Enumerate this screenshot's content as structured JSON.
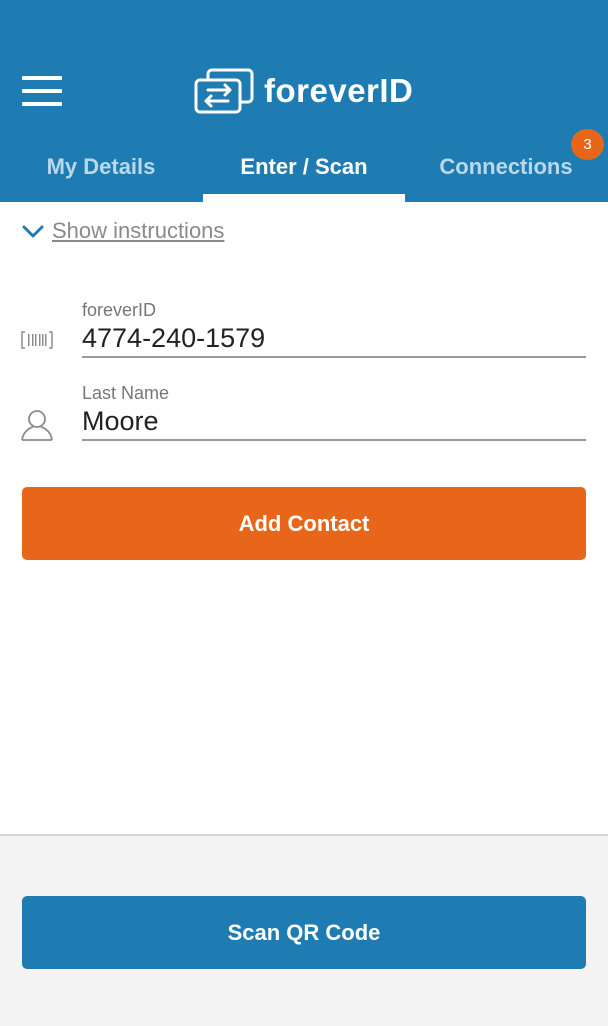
{
  "header": {
    "logo_text": "foreverID",
    "badge_count": "3",
    "tabs": [
      {
        "label": "My Details"
      },
      {
        "label": "Enter / Scan"
      },
      {
        "label": "Connections"
      }
    ],
    "colors": {
      "primary": "#1f7cb2",
      "accent": "#e8661a"
    }
  },
  "instructions": {
    "label": "Show instructions"
  },
  "form": {
    "foreverid": {
      "label": "foreverID",
      "value": "4774-240-1579"
    },
    "lastname": {
      "label": "Last Name",
      "value": "Moore"
    }
  },
  "buttons": {
    "add_contact": "Add Contact",
    "scan_qr": "Scan QR Code"
  },
  "icons": {
    "menu": "hamburger-icon",
    "logo": "exchange-arrows-icon",
    "instructions": "chevron-down-icon",
    "foreverid": "barcode-icon",
    "lastname": "user-icon"
  }
}
